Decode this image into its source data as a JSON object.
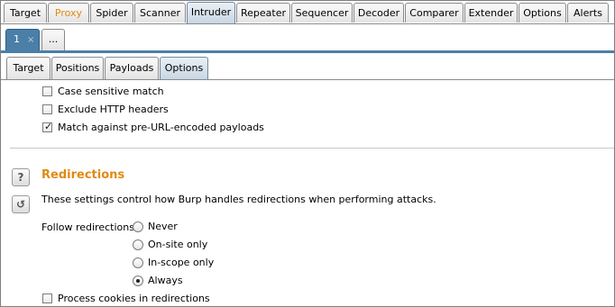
{
  "main_tabs": [
    {
      "label": "Target"
    },
    {
      "label": "Proxy"
    },
    {
      "label": "Spider"
    },
    {
      "label": "Scanner"
    },
    {
      "label": "Intruder"
    },
    {
      "label": "Repeater"
    },
    {
      "label": "Sequencer"
    },
    {
      "label": "Decoder"
    },
    {
      "label": "Comparer"
    },
    {
      "label": "Extender"
    },
    {
      "label": "Options"
    },
    {
      "label": "Alerts"
    }
  ],
  "main_tabs_selected": "Intruder",
  "proxy_tab_color": "#e08a13",
  "attack_tabs": {
    "current": "1",
    "current_close": "×",
    "more": "..."
  },
  "intruder_tabs": [
    {
      "label": "Target"
    },
    {
      "label": "Positions"
    },
    {
      "label": "Payloads"
    },
    {
      "label": "Options"
    }
  ],
  "intruder_tabs_selected": "Options",
  "grep_options": [
    {
      "label": "Case sensitive match",
      "checked": false
    },
    {
      "label": "Exclude HTTP headers",
      "checked": false
    },
    {
      "label": "Match against pre-URL-encoded payloads",
      "checked": true
    }
  ],
  "redirections": {
    "help_icon": "question-icon",
    "restore_icon": "restore-defaults-icon",
    "title": "Redirections",
    "title_color": "#e08a13",
    "description": "These settings control how Burp handles redirections when performing attacks.",
    "follow_label": "Follow redirections:",
    "follow_options": [
      {
        "label": "Never",
        "selected": false
      },
      {
        "label": "On-site only",
        "selected": false
      },
      {
        "label": "In-scope only",
        "selected": false
      },
      {
        "label": "Always",
        "selected": true
      }
    ],
    "process_cookies": {
      "label": "Process cookies in redirections",
      "checked": false
    }
  },
  "accent_color": "#4a7fa7"
}
